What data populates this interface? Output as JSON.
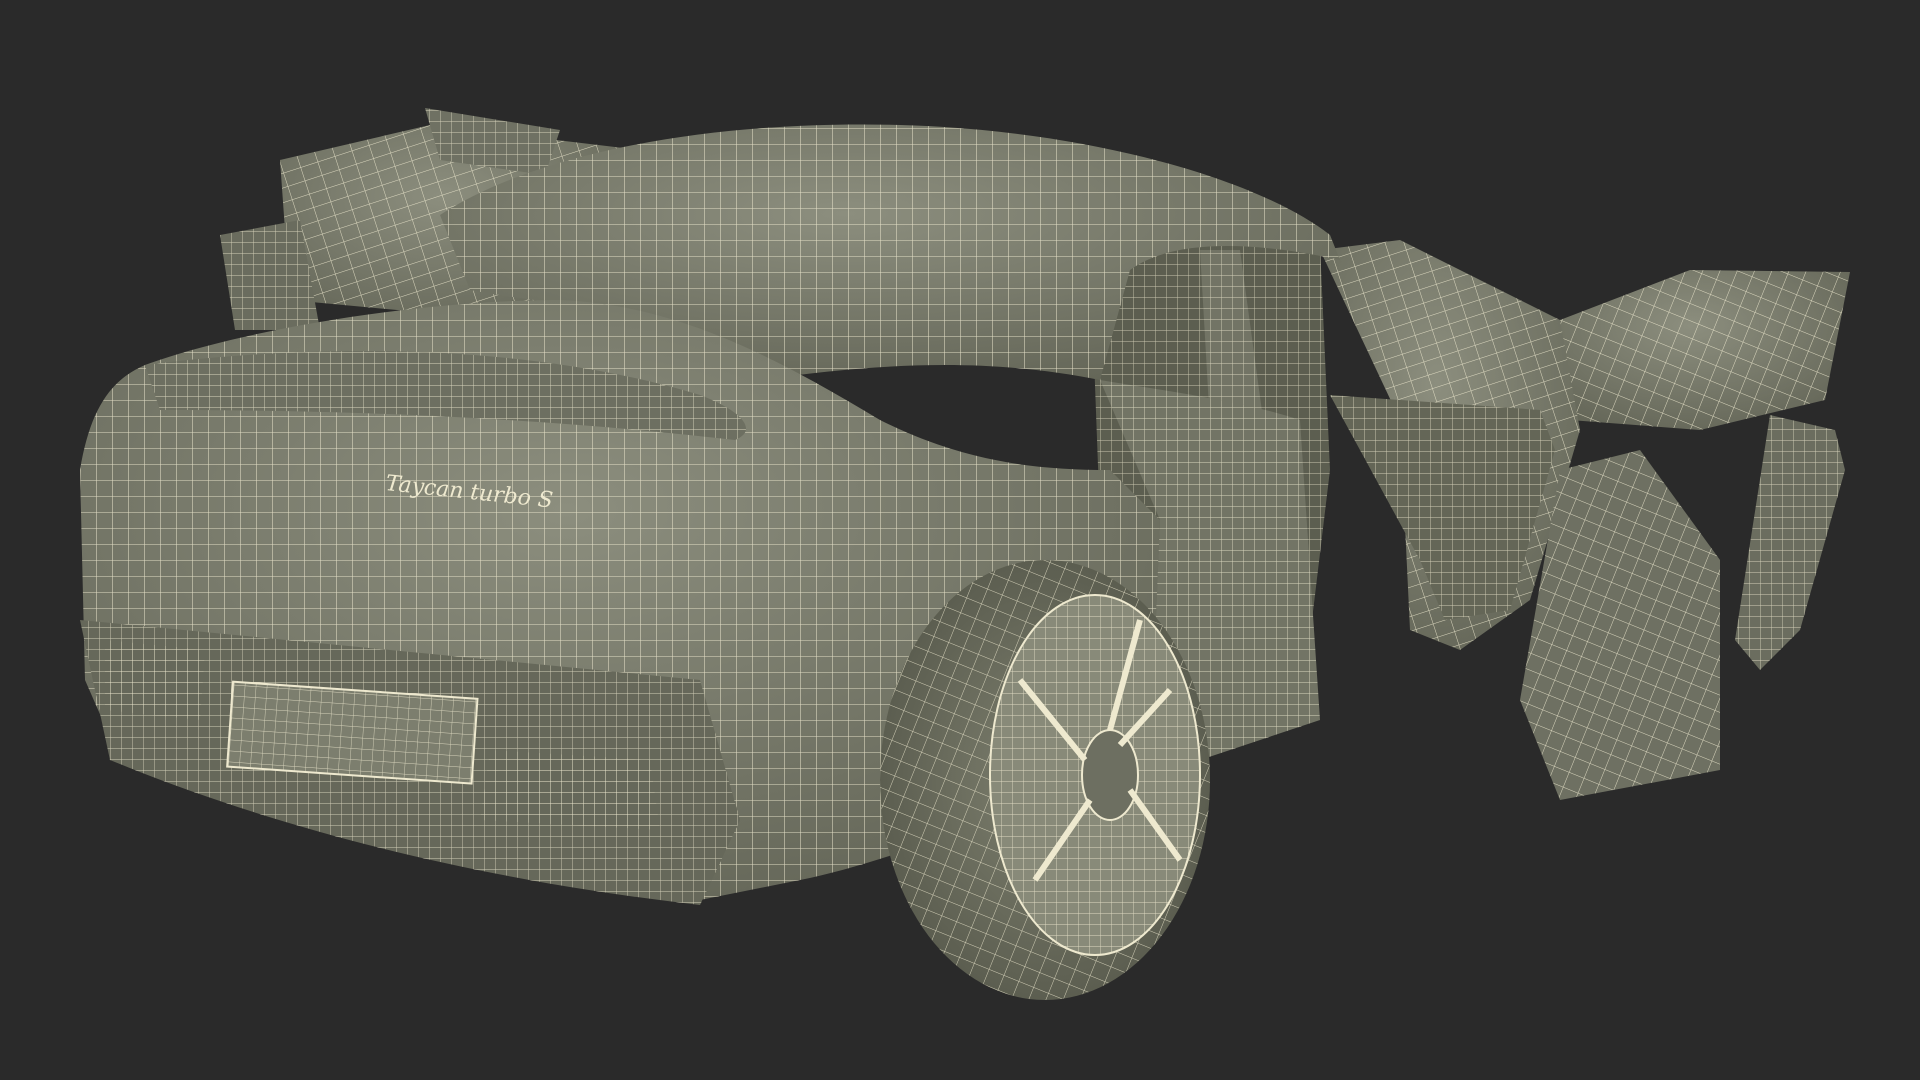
{
  "scene": {
    "background_color": "#2a2a2a",
    "surface_color": "#7c7e6e",
    "surface_shadow_color": "#5a5c4f",
    "surface_light_color": "#96988a",
    "wire_color": "#eee9cf",
    "logo_text": "Taycan turbo S"
  }
}
